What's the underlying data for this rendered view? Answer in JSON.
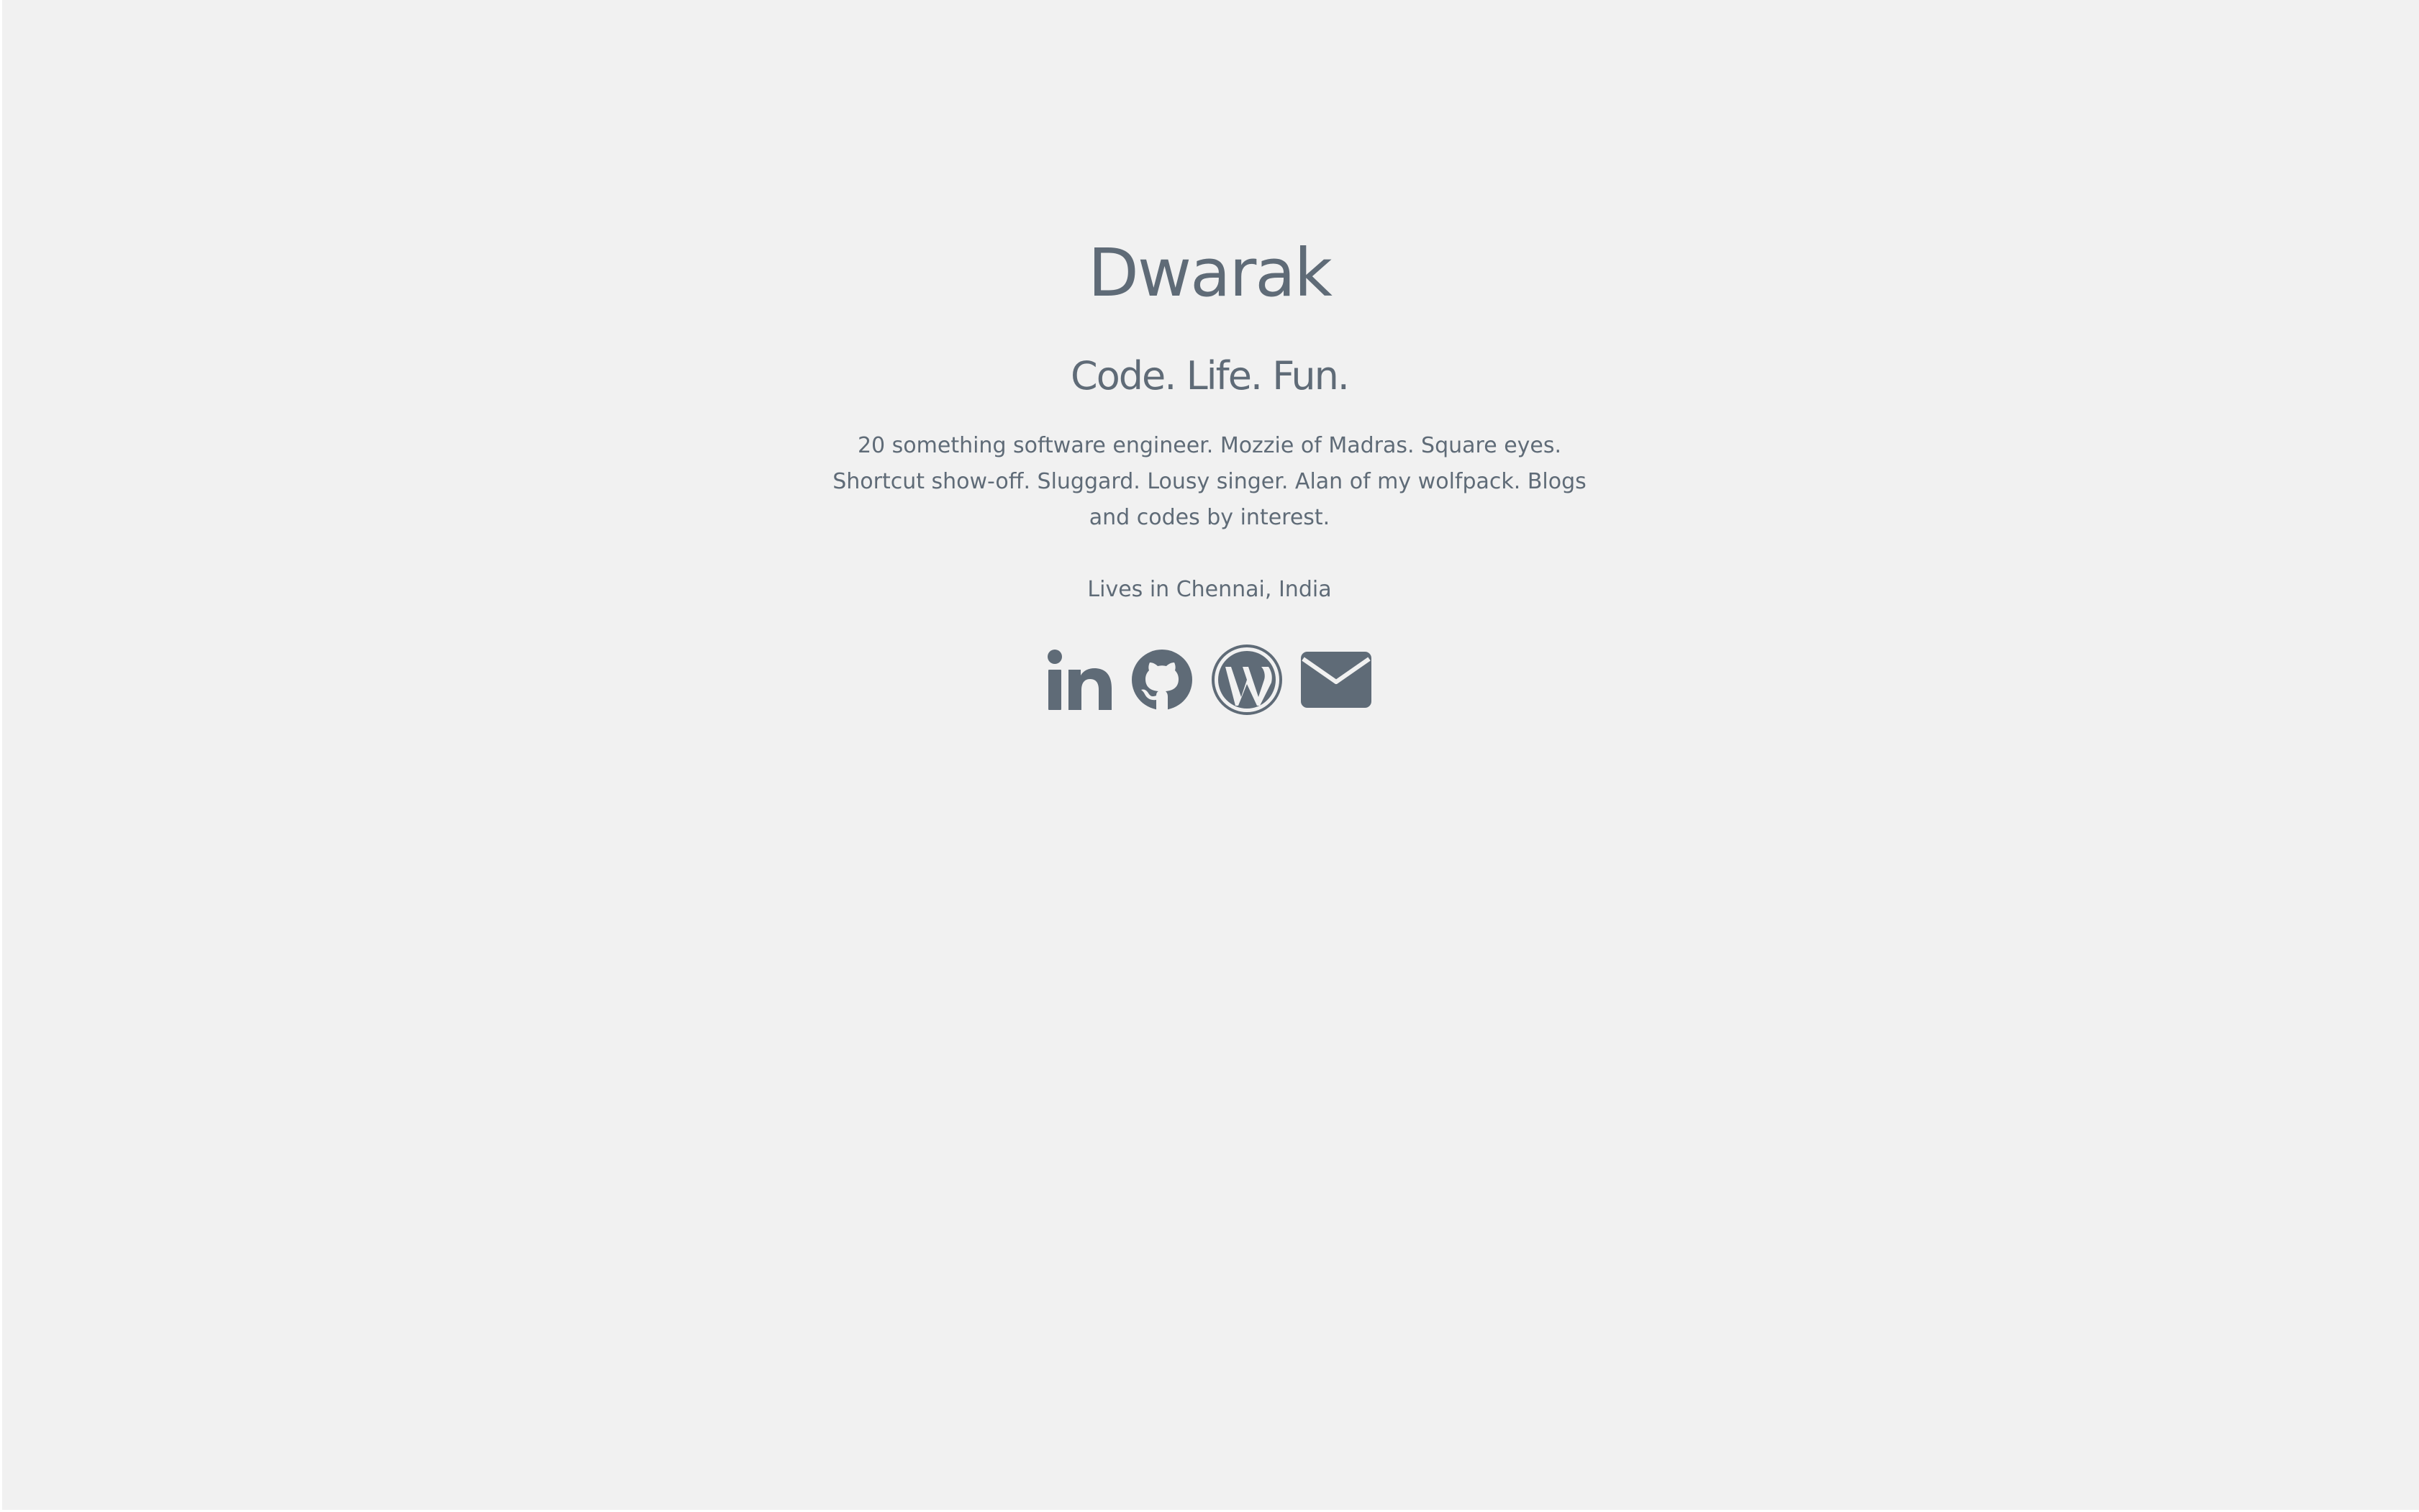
{
  "profile": {
    "name": "Dwarak",
    "tagline": "Code. Life. Fun.",
    "bio": "20 something software engineer. Mozzie of Madras. Square eyes. Shortcut show-off. Sluggard. Lousy singer. Alan of my wolfpack. Blogs and codes by interest.",
    "location": "Lives in Chennai, India"
  },
  "social": [
    {
      "icon": "linkedin-icon"
    },
    {
      "icon": "github-icon"
    },
    {
      "icon": "wordpress-icon"
    },
    {
      "icon": "email-icon"
    }
  ],
  "colors": {
    "background": "#f1f1f1",
    "text": "#5f6b77"
  }
}
